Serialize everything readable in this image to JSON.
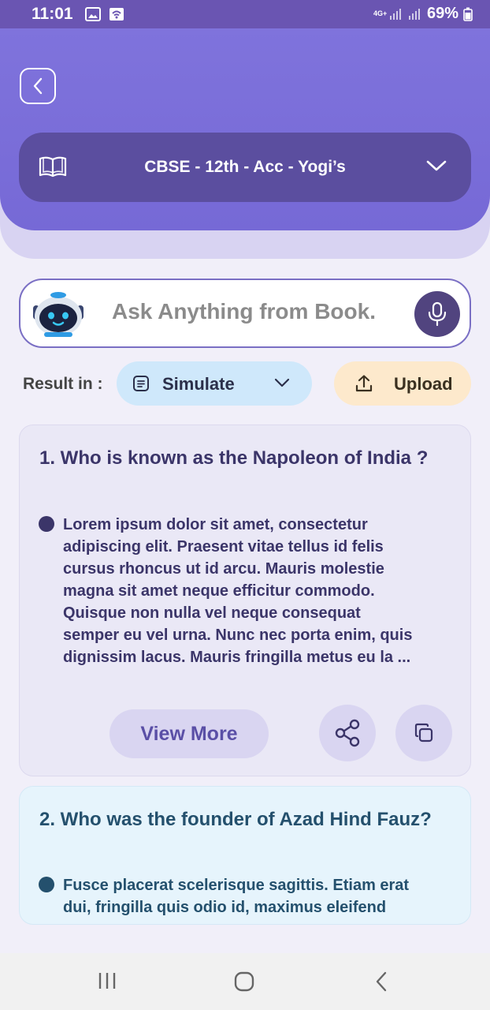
{
  "status_bar": {
    "time": "11:01",
    "network": "4G+",
    "battery": "69%"
  },
  "header": {
    "book_selector": {
      "label": "CBSE - 12th - Acc - Yogi’s"
    }
  },
  "search": {
    "placeholder": "Ask Anything from Book."
  },
  "result_in": {
    "label": "Result in :",
    "mode": "Simulate",
    "upload_label": "Upload"
  },
  "cards": [
    {
      "question": "1. Who is known as the Napoleon of India ?",
      "answer_lines": [
        "Lorem ipsum dolor sit amet, consectetur",
        "adipiscing elit. Praesent vitae tellus id felis",
        "cursus rhoncus ut id arcu. Mauris molestie",
        "magna sit amet neque efficitur commodo.",
        "Quisque non nulla vel neque consequat",
        "semper eu vel urna. Nunc nec porta enim, quis",
        "dignissim lacus. Mauris fringilla metus eu la ..."
      ],
      "view_more_label": "View More"
    },
    {
      "question": "2. Who was the founder of Azad Hind Fauz?",
      "answer_lines": [
        "Fusce placerat scelerisque sagittis. Etiam erat",
        "dui, fringilla quis odio id, maximus eleifend"
      ]
    }
  ],
  "colors": {
    "header": "#7669d6",
    "selector": "#5b4e9f",
    "card1_text": "#3b3569",
    "card2_text": "#24506d",
    "simulate_bg": "#cfe8fb",
    "upload_bg": "#fde9cc"
  }
}
